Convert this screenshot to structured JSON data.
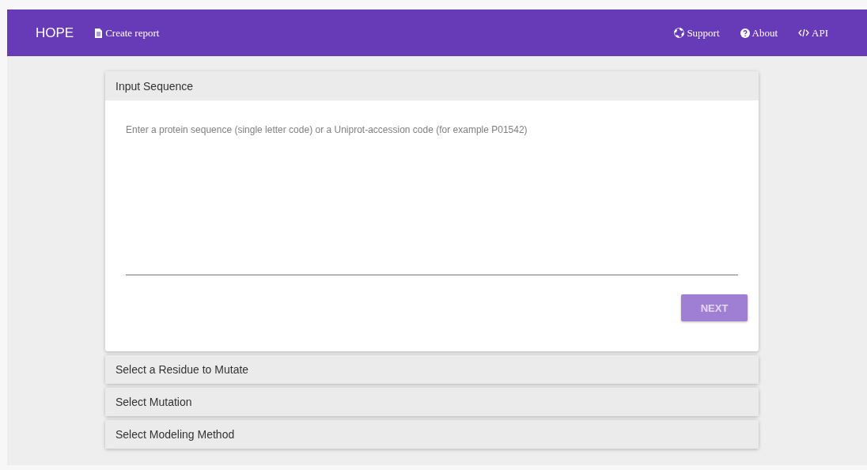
{
  "navbar": {
    "brand": "HOPE",
    "left_links": [
      {
        "label": "Create report",
        "kind": "document"
      }
    ],
    "right_links": [
      {
        "label": "Support",
        "kind": "lifebuoy"
      },
      {
        "label": "About",
        "kind": "question"
      },
      {
        "label": "API",
        "kind": "code"
      }
    ]
  },
  "steps": [
    {
      "title": "Input Sequence",
      "expanded": true,
      "placeholder": "Enter a protein sequence (single letter code) or a Uniprot-accession code (for example P01542)",
      "button": {
        "label": "NEXT",
        "disabled": true
      }
    },
    {
      "title": "Select a Residue to Mutate",
      "expanded": false
    },
    {
      "title": "Select Mutation",
      "expanded": false
    },
    {
      "title": "Select Modeling Method",
      "expanded": false
    }
  ]
}
